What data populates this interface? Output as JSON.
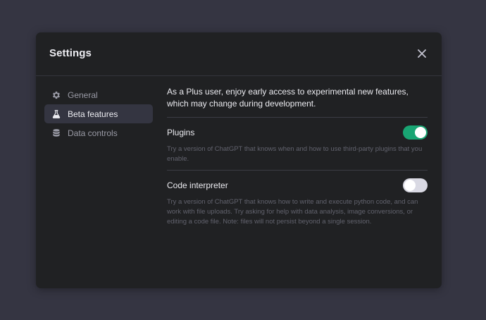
{
  "modal": {
    "title": "Settings"
  },
  "sidebar": {
    "items": [
      {
        "label": "General",
        "icon": "gear-icon",
        "active": false
      },
      {
        "label": "Beta features",
        "icon": "flask-icon",
        "active": true
      },
      {
        "label": "Data controls",
        "icon": "database-icon",
        "active": false
      }
    ]
  },
  "content": {
    "intro": "As a Plus user, enjoy early access to experimental new features, which may change during development.",
    "features": [
      {
        "name": "Plugins",
        "description": "Try a version of ChatGPT that knows when and how to use third-party plugins that you enable.",
        "enabled": true
      },
      {
        "name": "Code interpreter",
        "description": "Try a version of ChatGPT that knows how to write and execute python code, and can work with file uploads. Try asking for help with data analysis, image conversions, or editing a code file. Note: files will not persist beyond a single session.",
        "enabled": false
      }
    ]
  },
  "colors": {
    "toggle_on": "#19a573",
    "toggle_off": "#d9d9e3",
    "background": "#353542",
    "modal": "#202123",
    "active_item": "#343541"
  }
}
